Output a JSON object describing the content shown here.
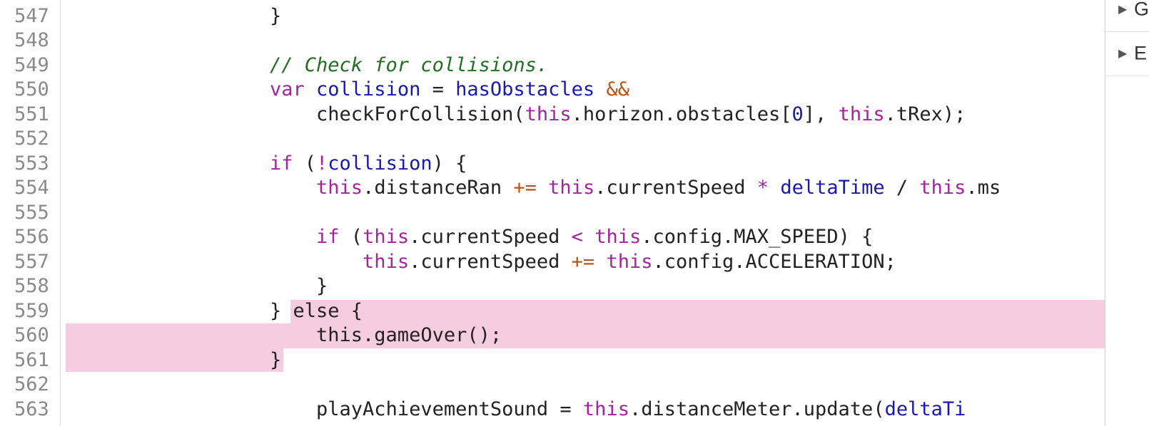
{
  "editor": {
    "lines": [
      {
        "num": "547",
        "tokens": [
          {
            "t": "}",
            "c": "punc"
          }
        ]
      },
      {
        "num": "548",
        "tokens": []
      },
      {
        "num": "549",
        "tokens": [
          {
            "t": "// Check for collisions.",
            "c": "com"
          }
        ]
      },
      {
        "num": "550",
        "tokens": [
          {
            "t": "var ",
            "c": "kw"
          },
          {
            "t": "collision",
            "c": "var"
          },
          {
            "t": " = ",
            "c": "punc"
          },
          {
            "t": "hasObstacles",
            "c": "var"
          },
          {
            "t": " ",
            "c": "punc"
          },
          {
            "t": "&&",
            "c": "amp"
          }
        ]
      },
      {
        "num": "551",
        "tokens": [
          {
            "t": "    checkForCollision(",
            "c": "id"
          },
          {
            "t": "this",
            "c": "this"
          },
          {
            "t": ".horizon.obstacles[",
            "c": "id"
          },
          {
            "t": "0",
            "c": "num"
          },
          {
            "t": "], ",
            "c": "id"
          },
          {
            "t": "this",
            "c": "this"
          },
          {
            "t": ".tRex);",
            "c": "id"
          }
        ]
      },
      {
        "num": "552",
        "tokens": []
      },
      {
        "num": "553",
        "tokens": [
          {
            "t": "if",
            "c": "kw"
          },
          {
            "t": " (",
            "c": "punc"
          },
          {
            "t": "!",
            "c": "op"
          },
          {
            "t": "collision",
            "c": "var"
          },
          {
            "t": ") {",
            "c": "punc"
          }
        ]
      },
      {
        "num": "554",
        "tokens": [
          {
            "t": "    ",
            "c": "punc"
          },
          {
            "t": "this",
            "c": "this"
          },
          {
            "t": ".distanceRan ",
            "c": "id"
          },
          {
            "t": "+=",
            "c": "amp"
          },
          {
            "t": " ",
            "c": "punc"
          },
          {
            "t": "this",
            "c": "this"
          },
          {
            "t": ".currentSpeed ",
            "c": "id"
          },
          {
            "t": "*",
            "c": "op"
          },
          {
            "t": " ",
            "c": "punc"
          },
          {
            "t": "deltaTime",
            "c": "var"
          },
          {
            "t": " / ",
            "c": "punc"
          },
          {
            "t": "this",
            "c": "this"
          },
          {
            "t": ".ms",
            "c": "id"
          }
        ]
      },
      {
        "num": "555",
        "tokens": []
      },
      {
        "num": "556",
        "tokens": [
          {
            "t": "    ",
            "c": "punc"
          },
          {
            "t": "if",
            "c": "kw"
          },
          {
            "t": " (",
            "c": "punc"
          },
          {
            "t": "this",
            "c": "this"
          },
          {
            "t": ".currentSpeed ",
            "c": "id"
          },
          {
            "t": "<",
            "c": "op"
          },
          {
            "t": " ",
            "c": "punc"
          },
          {
            "t": "this",
            "c": "this"
          },
          {
            "t": ".config.MAX_SPEED) {",
            "c": "id"
          }
        ]
      },
      {
        "num": "557",
        "tokens": [
          {
            "t": "        ",
            "c": "punc"
          },
          {
            "t": "this",
            "c": "this"
          },
          {
            "t": ".currentSpeed ",
            "c": "id"
          },
          {
            "t": "+=",
            "c": "amp"
          },
          {
            "t": " ",
            "c": "punc"
          },
          {
            "t": "this",
            "c": "this"
          },
          {
            "t": ".config.ACCELERATION;",
            "c": "id"
          }
        ]
      },
      {
        "num": "558",
        "tokens": [
          {
            "t": "    }",
            "c": "punc"
          }
        ]
      },
      {
        "num": "559",
        "tokens": [
          {
            "t": "} else {",
            "c": "punc"
          }
        ]
      },
      {
        "num": "560",
        "tokens": [
          {
            "t": "    this.gameOver();",
            "c": "punc"
          }
        ]
      },
      {
        "num": "561",
        "tokens": [
          {
            "t": "}",
            "c": "punc"
          }
        ]
      },
      {
        "num": "562",
        "tokens": []
      },
      {
        "num": "563",
        "tokens": [
          {
            "t": "    ",
            "c": "punc"
          },
          {
            "t": "playAchievementSound",
            "c": "id"
          },
          {
            "t": " = ",
            "c": "punc"
          },
          {
            "t": "this",
            "c": "this"
          },
          {
            "t": ".distanceMeter.update(",
            "c": "id"
          },
          {
            "t": "deltaTi",
            "c": "var"
          }
        ]
      }
    ]
  },
  "side_panel": {
    "items": [
      {
        "label": "G",
        "icon": "triangle-right-icon"
      },
      {
        "label": "E",
        "icon": "triangle-right-icon"
      }
    ]
  }
}
